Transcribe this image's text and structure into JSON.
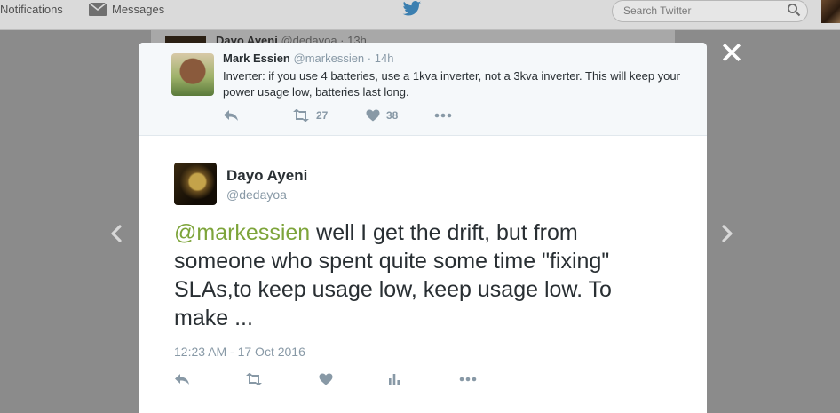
{
  "nav": {
    "notifications_label": "Notifications",
    "messages_label": "Messages",
    "search_placeholder": "Search Twitter"
  },
  "behind": {
    "name": "Dayo Ayeni",
    "handle": "@dedayoa",
    "time": "13h"
  },
  "parent_tweet": {
    "name": "Mark Essien",
    "handle": "@markessien",
    "time": "14h",
    "text": "Inverter: if you use 4 batteries, use a 1kva inverter, not a 3kva inverter. This will keep your power usage low, batteries last long.",
    "retweets": "27",
    "likes": "38"
  },
  "main_tweet": {
    "name": "Dayo Ayeni",
    "handle": "@dedayoa",
    "mention": "@markessien",
    "text": " well I get the drift, but from someone who spent quite some time \"fixing\" SLAs,to keep usage low, keep usage low. To make ...",
    "timestamp": "12:23 AM - 17 Oct 2016"
  },
  "icons": {
    "close": "close-icon",
    "prev": "chevron-left-icon",
    "next": "chevron-right-icon",
    "reply": "reply-icon",
    "retweet": "retweet-icon",
    "like": "heart-icon",
    "analytics": "analytics-icon",
    "more": "more-icon",
    "bird": "twitter-bird-icon",
    "search": "search-icon",
    "messages": "envelope-icon"
  },
  "colors": {
    "mention": "#7da43a",
    "icon_gray": "#8899a6",
    "text": "#292f33",
    "overlay": "#8b8b8b"
  }
}
